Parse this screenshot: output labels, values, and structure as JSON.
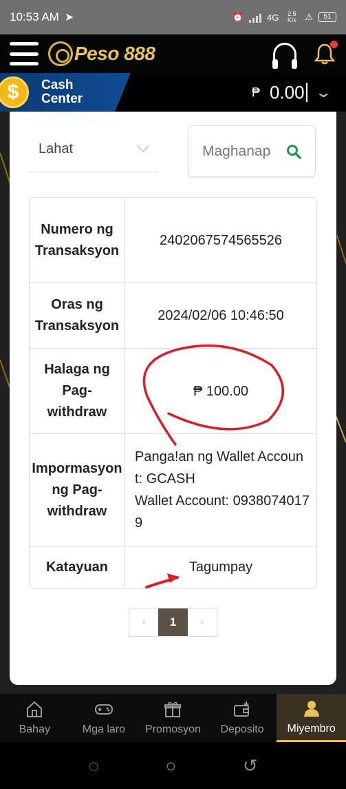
{
  "status_bar": {
    "time": "10:53 AM",
    "network_speed": "2.5 K/s",
    "network_type": "4G",
    "battery": "51"
  },
  "header": {
    "brand": "Peso 888",
    "icons": [
      "menu-icon",
      "support-headset-icon",
      "notification-bell-icon"
    ]
  },
  "cash_bar": {
    "label": "Cash\nCenter",
    "currency_symbol": "₱",
    "balance": "0.00"
  },
  "filters": {
    "select_value": "Lahat",
    "search_placeholder": "Maghanap"
  },
  "transaction": {
    "rows": [
      {
        "label": "Numero ng Transaksyon",
        "value": "2402067574565526"
      },
      {
        "label": "Oras ng Transaksyon",
        "value": "2024/02/06 10:46:50"
      },
      {
        "label": "Halaga ng Pag-withdraw",
        "value": "₱ 100.00"
      },
      {
        "label": "Impormasyon ng Pag-withdraw",
        "value_line1": "Panga!an ng Wallet Account: GCASH",
        "value_line2": "Wallet Account: 09380740179"
      },
      {
        "label": "Katayuan",
        "value": "Tagumpay"
      }
    ]
  },
  "pagination": {
    "prev": "‹",
    "current": "1",
    "next": "›"
  },
  "bottom_nav": {
    "items": [
      {
        "label": "Bahay",
        "icon": "home-icon"
      },
      {
        "label": "Mga laro",
        "icon": "gamepad-icon"
      },
      {
        "label": "Promosyon",
        "icon": "gift-icon"
      },
      {
        "label": "Deposito",
        "icon": "wallet-icon"
      },
      {
        "label": "Miyembro",
        "icon": "member-icon",
        "active": true
      }
    ]
  },
  "colors": {
    "gold": "#e8c25a",
    "annotation_red": "#d8202a",
    "cash_blue": "#0f4c92",
    "pager_active": "#5c5246"
  }
}
